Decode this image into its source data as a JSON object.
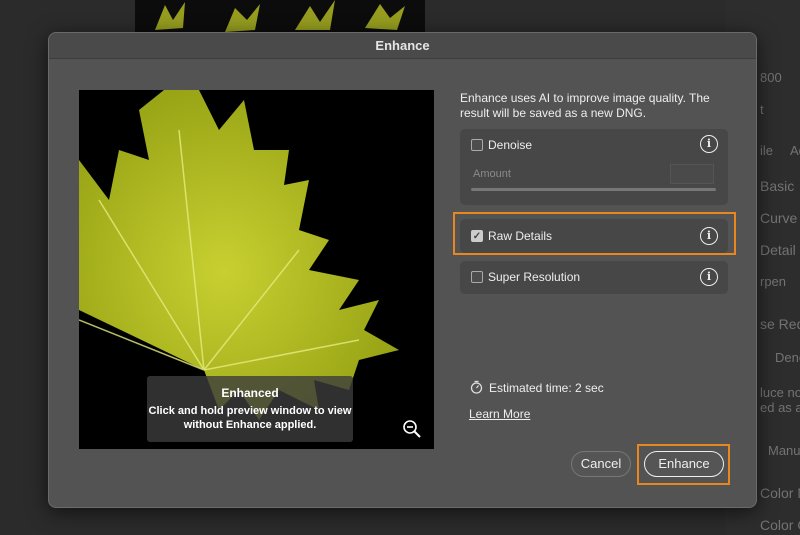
{
  "dialog": {
    "title": "Enhance",
    "description": "Enhance uses AI to improve image quality. The result will be saved as a new DNG.",
    "options": [
      {
        "label": "Denoise",
        "checked": false
      },
      {
        "label": "Raw Details",
        "checked": true
      },
      {
        "label": "Super Resolution",
        "checked": false
      }
    ],
    "amount_label": "Amount",
    "preview_overlay_title": "Enhanced",
    "preview_overlay_text": "Click and hold preview window to view without Enhance applied.",
    "estimated_time": "Estimated time: 2 sec",
    "learn_more": "Learn More",
    "cancel": "Cancel",
    "enhance": "Enhance"
  },
  "right_panel": [
    "800",
    "t",
    "ile",
    "Ad",
    "Basic",
    "Curve",
    "Detail",
    "rpen",
    "se Red",
    "Deno",
    "luce noi",
    "ed as a",
    "Manua",
    "Color M",
    "Color G"
  ],
  "colors": {
    "highlight": "#e8861f",
    "leaf": "#b8c21e"
  }
}
